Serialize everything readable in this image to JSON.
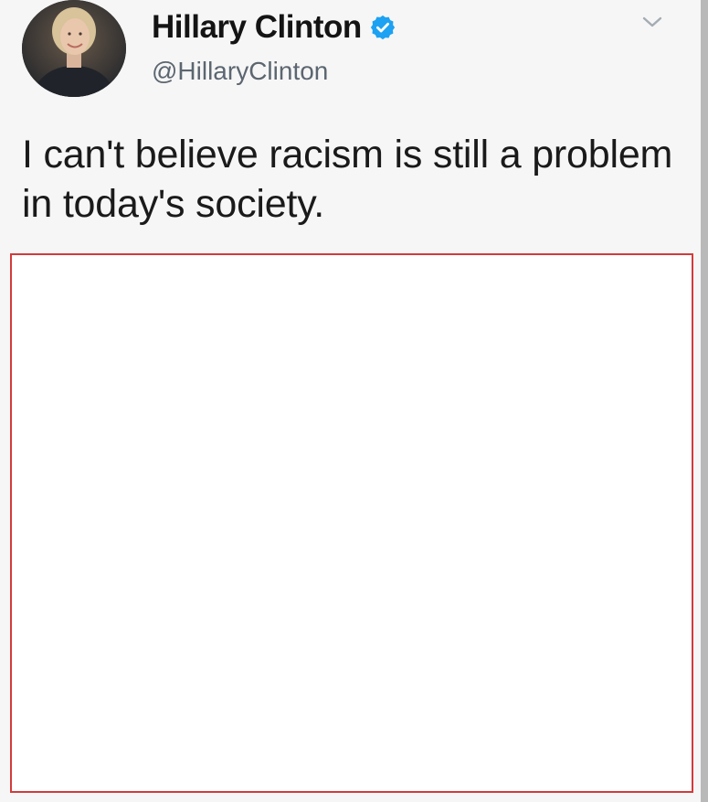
{
  "tweet": {
    "display_name": "Hillary Clinton",
    "handle": "@HillaryClinton",
    "text": "I can't believe racism is still a problem in today's society.",
    "verified": true,
    "icons": {
      "verified": "verified-badge-icon",
      "menu": "chevron-down-icon",
      "avatar": "profile-photo"
    },
    "colors": {
      "verified_badge": "#1da1f2",
      "frame_border": "#d23b3b"
    }
  }
}
